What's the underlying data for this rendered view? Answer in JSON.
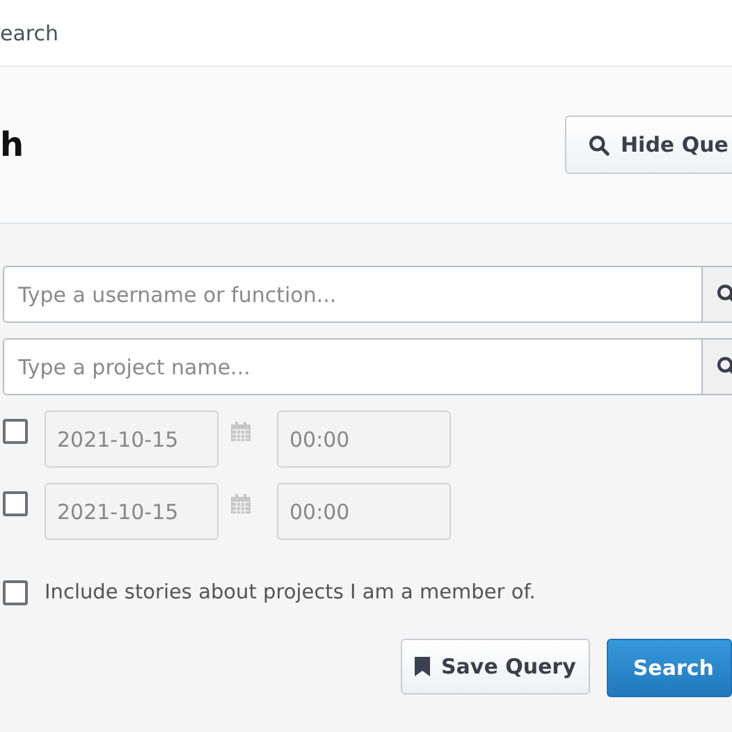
{
  "breadcrumb": "earch",
  "header": {
    "title": "h",
    "hide_button": "Hide Que"
  },
  "fields": [
    {
      "placeholder": "Type a username or function..."
    },
    {
      "placeholder": "Type a project name..."
    }
  ],
  "date_rows": [
    {
      "checked": false,
      "date": "2021-10-15",
      "time": "00:00"
    },
    {
      "checked": false,
      "date": "2021-10-15",
      "time": "00:00"
    }
  ],
  "include_member": {
    "checked": false,
    "label": "Include stories about projects I am a member of."
  },
  "buttons": {
    "save": "Save Query",
    "search": "Search"
  }
}
